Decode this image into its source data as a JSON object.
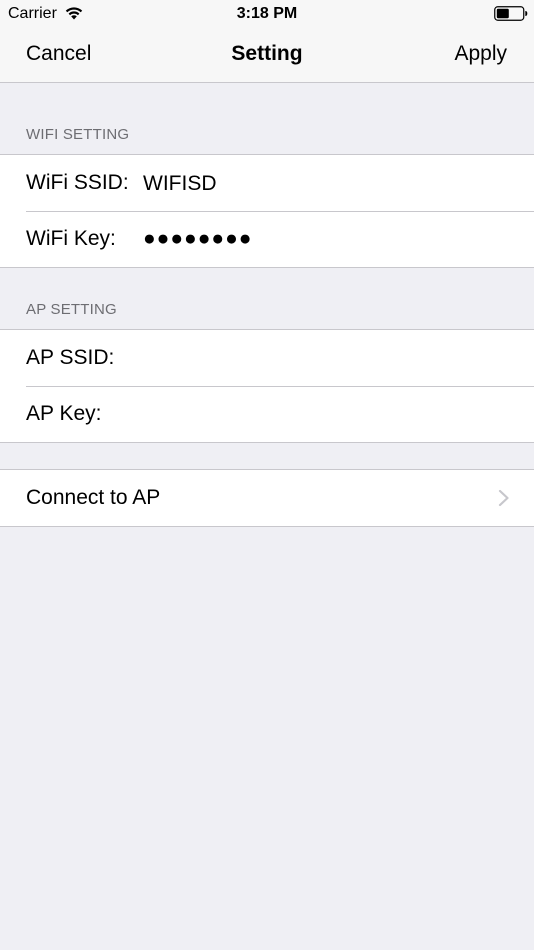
{
  "status_bar": {
    "carrier": "Carrier",
    "time": "3:18 PM"
  },
  "nav": {
    "cancel_label": "Cancel",
    "title": "Setting",
    "apply_label": "Apply"
  },
  "wifi_section": {
    "header": "WIFI SETTING",
    "ssid_label": "WiFi SSID:",
    "ssid_value": "WIFISD",
    "key_label": "WiFi Key:",
    "key_value": "●●●●●●●●"
  },
  "ap_section": {
    "header": "AP SETTING",
    "ssid_label": "AP SSID:",
    "ssid_value": "",
    "key_label": "AP Key:",
    "key_value": ""
  },
  "connect": {
    "label": "Connect to AP"
  },
  "colors": {
    "background": "#efeff4",
    "separator": "#c8c7cc",
    "section_header": "#6d6d72",
    "chevron": "#c7c7cc"
  },
  "icons": [
    "wifi-icon",
    "battery-icon",
    "chevron-right-icon"
  ]
}
